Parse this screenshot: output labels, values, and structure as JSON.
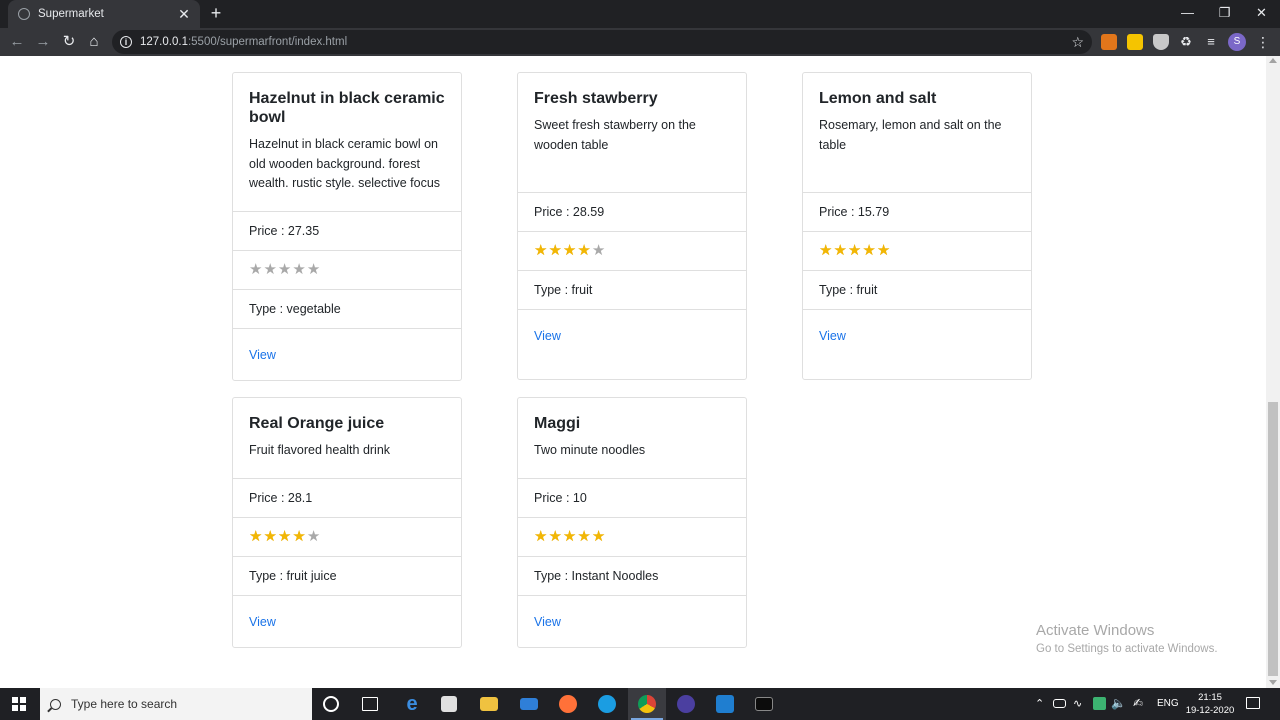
{
  "browser": {
    "tab_title": "Supermarket",
    "tab_close": "✕",
    "new_tab": "+",
    "url_host": "127.0.0.1",
    "url_path": ":5500/supermarfront/index.html",
    "profile_initial": "S"
  },
  "products": [
    {
      "title": "Hazelnut in black ceramic bowl",
      "description": "Hazelnut in black ceramic bowl on old wooden background. forest wealth. rustic style. selective focus",
      "price": "Price : 27.35",
      "rating": 0,
      "type": "Type : vegetable",
      "link": "View"
    },
    {
      "title": "Fresh stawberry",
      "description": "Sweet fresh stawberry on the wooden table",
      "price": "Price : 28.59",
      "rating": 4,
      "type": "Type : fruit",
      "link": "View"
    },
    {
      "title": "Lemon and salt",
      "description": "Rosemary, lemon and salt on the table",
      "price": "Price : 15.79",
      "rating": 5,
      "type": "Type : fruit",
      "link": "View"
    },
    {
      "title": "Real Orange juice",
      "description": "Fruit flavored health drink",
      "price": "Price : 28.1",
      "rating": 4,
      "type": "Type : fruit juice",
      "link": "View"
    },
    {
      "title": "Maggi",
      "description": "Two minute noodles",
      "price": "Price : 10",
      "rating": 5,
      "type": "Type : Instant Noodles",
      "link": "View"
    }
  ],
  "rating_max": 5,
  "watermark": {
    "title": "Activate Windows",
    "subtitle": "Go to Settings to activate Windows."
  },
  "taskbar": {
    "search_placeholder": "Type here to search",
    "language": "ENG",
    "time": "21:15",
    "date": "19-12-2020"
  },
  "colors": {
    "star_on": "#f2b705",
    "star_off": "#a9a9a9",
    "link": "#1a73e8"
  }
}
